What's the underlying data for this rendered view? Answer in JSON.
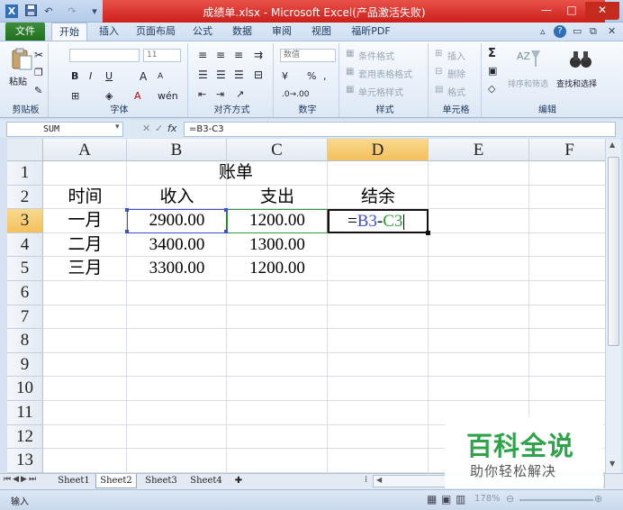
{
  "titlebar": {
    "title": "成绩单.xlsx - Microsoft Excel(产品激活失败)",
    "qat_undo": "↶",
    "qat_redo": "↷",
    "minimize": "—",
    "maximize": "□",
    "close": "✕"
  },
  "ribbon_tabs": {
    "file": "文件",
    "items": [
      "开始",
      "插入",
      "页面布局",
      "公式",
      "数据",
      "审阅",
      "视图",
      "福昕PDF"
    ],
    "help": "?"
  },
  "ribbon": {
    "clipboard": {
      "label": "剪贴板",
      "paste": "粘贴"
    },
    "font": {
      "label": "字体",
      "size": "11",
      "bold": "B",
      "italic": "I",
      "underline": "U",
      "grow": "A",
      "shrink": "A"
    },
    "alignment": {
      "label": "对齐方式"
    },
    "number": {
      "label": "数字",
      "format": "数值",
      "percent": "%",
      "comma": ","
    },
    "styles": {
      "label": "样式",
      "conditional": "条件格式",
      "table": "套用表格格式",
      "cell": "单元格样式"
    },
    "cells": {
      "label": "单元格",
      "insert": "插入",
      "delete": "删除",
      "format": "格式"
    },
    "editing": {
      "label": "编辑",
      "sigma": "Σ",
      "sort": "排序和筛选",
      "find": "查找和选择"
    }
  },
  "formula_bar": {
    "name_box": "SUM",
    "cancel": "✕",
    "enter": "✓",
    "fx": "fx",
    "formula": "=B3-C3"
  },
  "columns": [
    "A",
    "B",
    "C",
    "D",
    "E",
    "F"
  ],
  "rows": [
    "1",
    "2",
    "3",
    "4",
    "5",
    "6",
    "7",
    "8",
    "9",
    "10",
    "11",
    "12",
    "13"
  ],
  "sheet": {
    "title": "账单",
    "headers": [
      "时间",
      "收入",
      "支出",
      "结余"
    ],
    "data": [
      [
        "一月",
        "2900.00",
        "1200.00"
      ],
      [
        "二月",
        "3400.00",
        "1300.00"
      ],
      [
        "三月",
        "3300.00",
        "1200.00"
      ]
    ],
    "editing_formula": {
      "eq": "=",
      "ref1": "B3",
      "minus": "-",
      "ref2": "C3"
    }
  },
  "sheet_tabs": [
    "Sheet1",
    "Sheet2",
    "Sheet3",
    "Sheet4"
  ],
  "status": {
    "mode": "输入",
    "zoom": "178%"
  },
  "watermark": {
    "main": "百科全说",
    "sub": "助你轻松解决"
  },
  "colors": {
    "ref1": "#3b4fd6",
    "ref2": "#2e9b3a",
    "selected_header": "#f3c05b",
    "watermark_green": "#2fa34a"
  }
}
